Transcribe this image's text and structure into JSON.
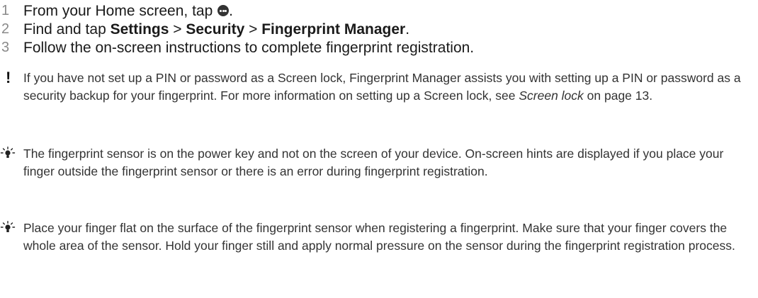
{
  "steps": [
    {
      "number": "1",
      "text_before": "From your Home screen, tap ",
      "icon": "apps-icon",
      "text_after": "."
    },
    {
      "number": "2",
      "prefix": "Find and tap ",
      "settings": "Settings",
      "sep1": " > ",
      "security": "Security",
      "sep2": " > ",
      "fingerprint_manager": "Fingerprint Manager",
      "suffix": "."
    },
    {
      "number": "3",
      "text": "Follow the on-screen instructions to complete fingerprint registration."
    }
  ],
  "notes": [
    {
      "icon": "exclamation-icon",
      "text_before": "If you have not set up a PIN or password as a Screen lock, Fingerprint Manager assists you with setting up a PIN or password as a security backup for your fingerprint. For more information on setting up a Screen lock, see ",
      "link": "Screen lock",
      "text_after": " on page 13."
    },
    {
      "icon": "lightbulb-icon",
      "text": "The fingerprint sensor is on the power key and not on the screen of your device. On-screen hints are displayed if you place your finger outside the fingerprint sensor or there is an error during fingerprint registration."
    },
    {
      "icon": "lightbulb-icon",
      "text": "Place your finger flat on the surface of the fingerprint sensor when registering a fingerprint. Make sure that your finger covers the whole area of the sensor. Hold your finger still and apply normal pressure on the sensor during the fingerprint registration process."
    }
  ]
}
